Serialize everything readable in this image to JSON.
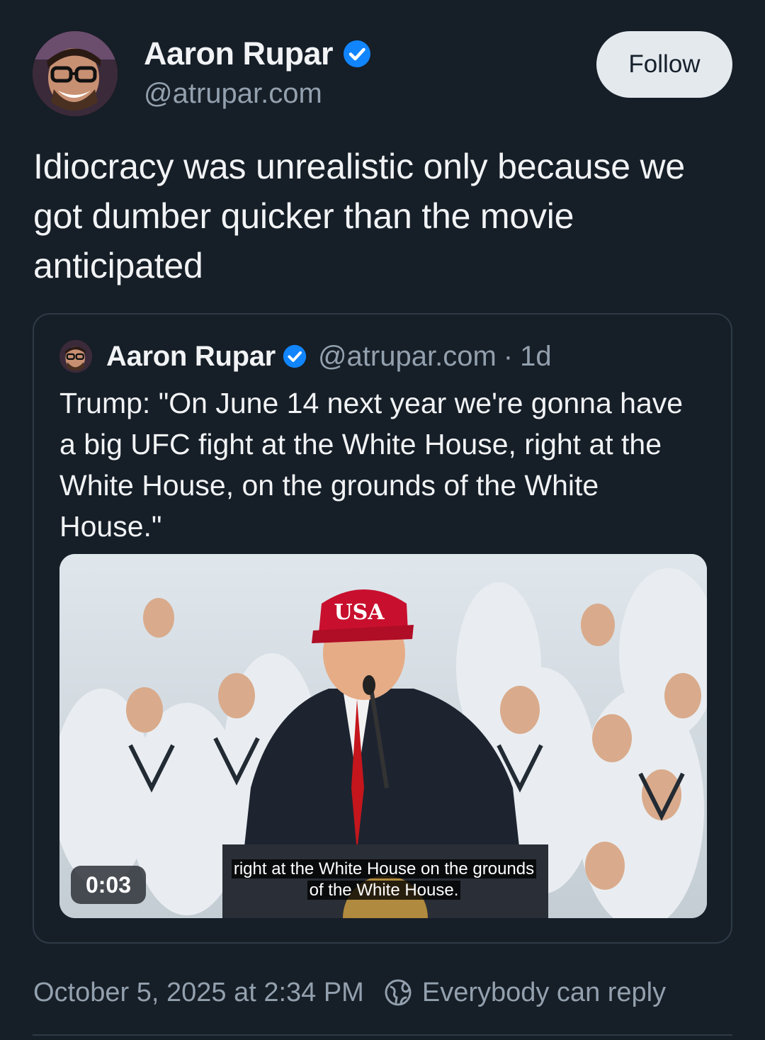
{
  "author": {
    "name": "Aaron Rupar",
    "handle": "@atrupar.com",
    "verified": true
  },
  "follow_label": "Follow",
  "post_text": "Idiocracy was unrealistic only because we got dumber quicker than the movie anticipated",
  "quote": {
    "name": "Aaron Rupar",
    "handle": "@atrupar.com",
    "separator": "·",
    "time": "1d",
    "text": "Trump: \"On June 14 next year we're gonna have a big UFC fight at the White House, right at the White House, on the grounds of the White House.\"",
    "video": {
      "duration": "0:03",
      "caption_line1": "right at the White House on the grounds",
      "caption_line2": "of the White House.",
      "hat_text": "USA"
    }
  },
  "footer": {
    "timestamp": "October 5, 2025 at 2:34 PM",
    "reply_setting": "Everybody can reply",
    "reply_icon": "globe-icon"
  },
  "colors": {
    "background": "#161e27",
    "verified_blue": "#1185fe",
    "muted_text": "#93a0ae",
    "border": "#2e3a47"
  }
}
